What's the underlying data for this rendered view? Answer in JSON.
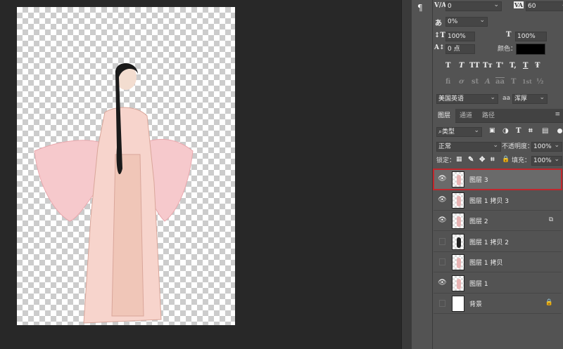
{
  "character": {
    "kerning": "0",
    "tracking": "60",
    "baseline_shift_pct": "0%",
    "vertical_scale": "100%",
    "horizontal_scale": "100%",
    "baseline": "0 点",
    "color_label": "颜色：",
    "color": "#000000",
    "style_buttons": [
      "T",
      "T",
      "TT",
      "Tт",
      "T'",
      "T,",
      "T",
      "Ŧ"
    ],
    "opentype_buttons": [
      "fi",
      "ơ",
      "st",
      "A",
      "aa",
      "T",
      "1st",
      "½"
    ],
    "language": "美国英语",
    "aa_label": "aa",
    "antialias": "浑厚"
  },
  "layers_panel": {
    "tabs": [
      {
        "label": "图层",
        "active": true
      },
      {
        "label": "通道"
      },
      {
        "label": "路径"
      }
    ],
    "filter": "类型",
    "blend_mode": "正常",
    "opacity_label": "不透明度：",
    "opacity": "100%",
    "lock_label": "锁定：",
    "fill_label": "填充：",
    "fill": "100%",
    "layers": [
      {
        "name": "图层 3",
        "visible": true,
        "selected": true
      },
      {
        "name": "图层 1 拷贝 3",
        "visible": true
      },
      {
        "name": "图层 2",
        "visible": true,
        "badge": "⧉"
      },
      {
        "name": "图层 1 拷贝 2",
        "visible": false,
        "thumb": "dark"
      },
      {
        "name": "图层 1 拷贝",
        "visible": false
      },
      {
        "name": "图层 1",
        "visible": true
      },
      {
        "name": "背景",
        "visible": false,
        "thumb": "white",
        "badge": "🔒"
      }
    ]
  },
  "colors": {
    "selection_outline": "#c0272d",
    "panel_bg": "#535353",
    "canvas_bg": "#282828"
  }
}
